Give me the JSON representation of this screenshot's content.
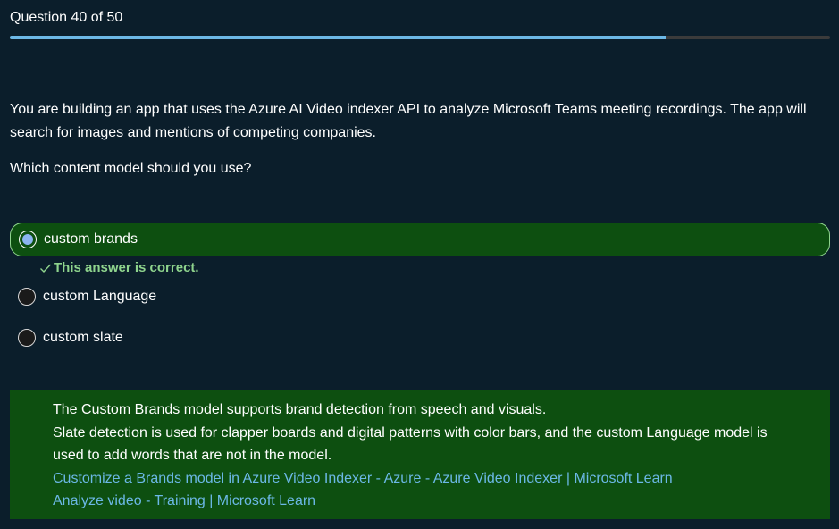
{
  "header": {
    "title": "Question 40 of 50",
    "progress": 0.8
  },
  "question": {
    "text": "You are building an app that uses the Azure AI Video indexer API to analyze Microsoft Teams meeting recordings. The app will search for images and mentions of competing companies.",
    "prompt": "Which content model should you use?"
  },
  "options": [
    {
      "label": "custom brands",
      "selected": true
    },
    {
      "label": "custom Language",
      "selected": false
    },
    {
      "label": "custom slate",
      "selected": false
    }
  ],
  "feedback": {
    "text": "This answer is correct."
  },
  "explanation": {
    "line1": "The Custom Brands model supports brand detection from speech and visuals.",
    "line2": "Slate detection is used for clapper boards and digital patterns with color bars, and the custom Language model is used to add words that are not in the model.",
    "links": [
      "Customize a Brands model in Azure Video Indexer - Azure - Azure Video Indexer | Microsoft Learn",
      "Analyze video - Training | Microsoft Learn"
    ]
  },
  "colors": {
    "background": "#0b1e2b",
    "accent": "#6cb8e6",
    "correct_bg": "#0d4f10",
    "correct_text": "#8fd48d"
  }
}
